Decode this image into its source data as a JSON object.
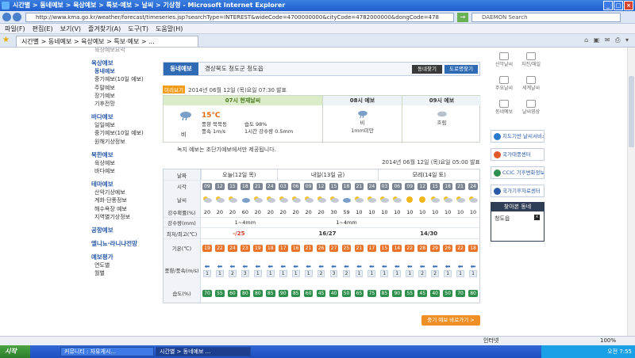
{
  "browser": {
    "title": "시간별 > 동네예보 > 육상예보 > 특보·예보 > 날씨 > 기상청 - Microsoft Internet Explorer",
    "url": "http://www.kma.go.kr/weather/forecast/timeseries.jsp?searchType=INTEREST&wideCode=4700000000&cityCode=4782000000&dongCode=478",
    "search_text": "DAEMON Search",
    "menu": [
      "파일(F)",
      "편집(E)",
      "보기(V)",
      "즐겨찾기(A)",
      "도구(T)",
      "도움말(H)"
    ],
    "tab_label": "시간별 > 동네예보 > 육상예보 > 특보·예보 > ...",
    "status_left": "",
    "zone": "인터넷",
    "zoom": "100%"
  },
  "left_nav": {
    "partial_top": "육상예보요약",
    "sections": [
      {
        "title": "육상예보",
        "items": [
          "동네예보",
          "중기예보(10일 예보)",
          "주말예보",
          "장기예보",
          "기후전망"
        ]
      },
      {
        "title": "바다예보",
        "items": [
          "일일예보",
          "중기예보(10일 예보)",
          "원해기상정보"
        ]
      },
      {
        "title": "북한예보",
        "items": [
          "육상예보",
          "바다예보"
        ]
      },
      {
        "title": "테마예보",
        "items": [
          "산악기상예보",
          "계화·단풍정보",
          "해수욕장 예보",
          "지역별기상정보"
        ]
      },
      {
        "title": "공항예보",
        "items": []
      },
      {
        "title": "엘니뇨·라니냐전망",
        "items": []
      },
      {
        "title": "예보평가",
        "items": [
          "연도별",
          "월별"
        ]
      }
    ],
    "active": "동네예보"
  },
  "search_panel": {
    "label": "동네예보",
    "location": "경상북도 청도군 청도읍",
    "btn_find": "동네찾기",
    "btn_road": "도로명찾기"
  },
  "announce": {
    "badge": "미리보기",
    "text": "2014년 06월 12일 (목)요일 07:30 발표"
  },
  "summary": {
    "today_header": "07시 현재날씨",
    "d8_header": "08시 예보",
    "d9_header": "09시 예보",
    "temp": "15℃",
    "c1": [
      "풍향 북북동",
      "풍속 1m/s"
    ],
    "c2": [
      "습도 98%",
      "1시간 강수량 0.5mm"
    ],
    "cond_now": "비",
    "cond8": "비",
    "rain8": "1mm미만",
    "cond9": "흐림"
  },
  "note": "녹지 예보는 초단기예보에서만 제공됩니다.",
  "issue_time": "2014년 06월 12일 (목)요일 05:00 발표",
  "table": {
    "labels": {
      "day": "날짜",
      "hour": "시각",
      "sky": "날씨",
      "pop": "강수확률(%)",
      "rain": "강수량(mm)",
      "minmax": "최저/최고(℃)",
      "temp": "기온(℃)",
      "wind": "풍향/풍속(m/s)",
      "humid": "습도(%)"
    },
    "days": [
      "오늘(12일 목)",
      "내일(13일 금)",
      "모레(14일 토)"
    ],
    "hours": [
      "09",
      "12",
      "15",
      "18",
      "21",
      "24",
      "03",
      "06",
      "09",
      "12",
      "15",
      "18",
      "21",
      "24",
      "03",
      "06",
      "09",
      "12",
      "15",
      "18",
      "21",
      "24"
    ],
    "pop": [
      "20",
      "20",
      "20",
      "60",
      "20",
      "20",
      "20",
      "20",
      "20",
      "20",
      "30",
      "59",
      "10",
      "10",
      "10",
      "10",
      "10",
      "10",
      "10",
      "10",
      "10",
      "10"
    ],
    "rain": [
      "",
      "",
      "",
      "1~4mm",
      "",
      "",
      "",
      "",
      "",
      "",
      "",
      "1~4mm",
      "",
      "",
      "",
      "",
      "",
      "",
      "",
      "",
      "",
      ""
    ],
    "minmax": [
      "-/25",
      "16/27",
      "14/30"
    ],
    "temps": [
      "19",
      "22",
      "24",
      "23",
      "19",
      "18",
      "17",
      "16",
      "21",
      "26",
      "27",
      "25",
      "21",
      "17",
      "15",
      "14",
      "22",
      "28",
      "29",
      "26",
      "22",
      "18"
    ],
    "winds": [
      "1",
      "1",
      "2",
      "3",
      "1",
      "1",
      "1",
      "1",
      "1",
      "2",
      "3",
      "2",
      "1",
      "1",
      "1",
      "1",
      "1",
      "2",
      "2",
      "1",
      "1",
      "1"
    ],
    "humid": [
      "70",
      "55",
      "60",
      "80",
      "80",
      "85",
      "90",
      "85",
      "60",
      "45",
      "40",
      "50",
      "65",
      "75",
      "85",
      "90",
      "55",
      "45",
      "40",
      "50",
      "70",
      "80"
    ]
  },
  "more_button": "중기 예보 바로가기 >",
  "right_rail": {
    "icons": [
      "산악날씨",
      "지진/해일",
      "주요날씨",
      "세계날씨",
      "동네예보",
      "날씨영상"
    ],
    "banners": [
      "지도기반 날씨서비스 GIS Service",
      "국가태풍센터",
      "CCIC 기후변화정보센터",
      "국가기후자료센터"
    ],
    "fav_title": "찾아본 동네",
    "fav_item": "청도읍"
  },
  "taskbar": {
    "start": "시작",
    "tasks": [
      "커뮤니티 : 자유게시...",
      "시간별 > 동네예보 ..."
    ],
    "clock": "오전 7:55"
  }
}
